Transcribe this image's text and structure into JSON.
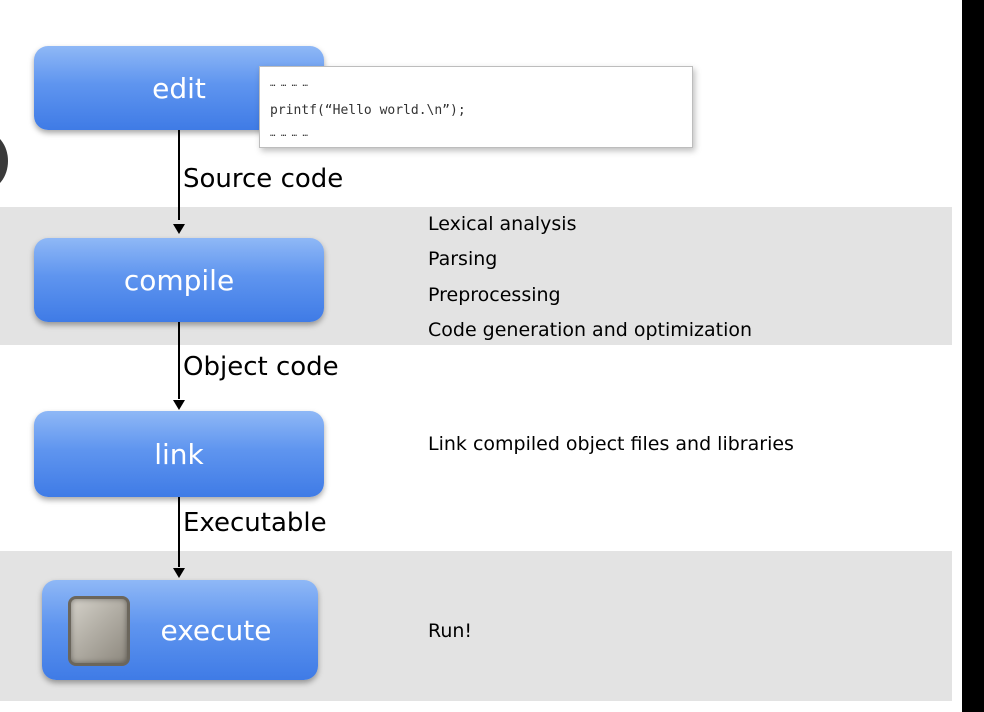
{
  "steps": {
    "edit": "edit",
    "compile": "compile",
    "link": "link",
    "execute": "execute"
  },
  "code_snippet": {
    "dots_top": "… … … …",
    "line": "printf(“Hello world.\\n”);",
    "dots_bottom": "… … … …"
  },
  "flow_labels": {
    "source": "Source code",
    "object": "Object code",
    "executable": "Executable"
  },
  "compile_notes": [
    "Lexical analysis",
    "Parsing",
    "Preprocessing",
    "Code generation and optimization"
  ],
  "link_note": "Link compiled object files and libraries",
  "execute_note": "Run!"
}
